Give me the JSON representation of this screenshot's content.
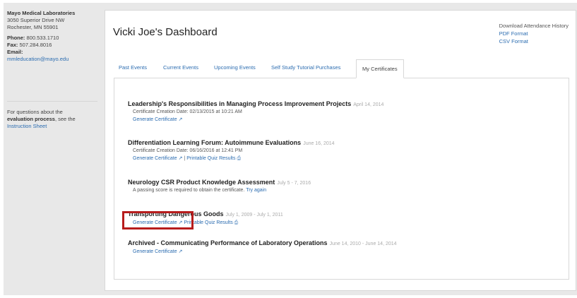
{
  "sidebar": {
    "org_name": "Mayo Medical Laboratories",
    "address_line1": "3050 Superior Drive NW",
    "address_line2": "Rochester, MN 55901",
    "phone_label": "Phone:",
    "phone": "800.533.1710",
    "fax_label": "Fax:",
    "fax": "507.284.8016",
    "email_label": "Email:",
    "email": "mmleducation@mayo.edu",
    "questions_prefix": "For questions about the",
    "questions_bold": "evaluation process",
    "questions_suffix": ", see the",
    "instruction_link": "Instruction Sheet"
  },
  "header": {
    "title": "Vicki Joe's Dashboard",
    "download_heading": "Download Attendance History",
    "pdf_link": "PDF Format",
    "csv_link": "CSV Format"
  },
  "tabs": [
    {
      "label": "Past Events"
    },
    {
      "label": "Current Events"
    },
    {
      "label": "Upcoming Events"
    },
    {
      "label": "Self Study Tutorial Purchases"
    },
    {
      "label": "My Certificates"
    }
  ],
  "events": [
    {
      "name": "Leadership's Responsibilities in Managing Process Improvement Projects",
      "date": "April 14, 2014",
      "created": "Certificate Creation Date: 02/13/2015 at 10:21 AM",
      "generate": "Generate Certificate"
    },
    {
      "name": "Differentiation Learning Forum: Autoimmune Evaluations",
      "date": "June 16, 2014",
      "created": "Certificate Creation Date: 06/16/2016 at 12:41 PM",
      "generate": "Generate Certificate",
      "separator": "|",
      "quiz": "Printable Quiz Results"
    },
    {
      "name": "Neurology CSR Product Knowledge Assessment",
      "date": "July 5 - 7, 2016",
      "message": "A passing score is required to obtain the certificate.",
      "try_again": "Try again"
    },
    {
      "name": "Transporting Dangerous Goods",
      "date": "July 1, 2009 - July 1, 2011",
      "generate": "Generate Certificate",
      "quiz": "Printable Quiz Results"
    },
    {
      "name": "Archived - Communicating Performance of Laboratory Operations",
      "date": "June 14, 2010 - June 14, 2014",
      "generate": "Generate Certificate"
    }
  ],
  "icons": {
    "external": "external-link-icon",
    "print": "print-icon"
  },
  "colors": {
    "link": "#2b6cb0",
    "highlight": "#b71c1c"
  }
}
